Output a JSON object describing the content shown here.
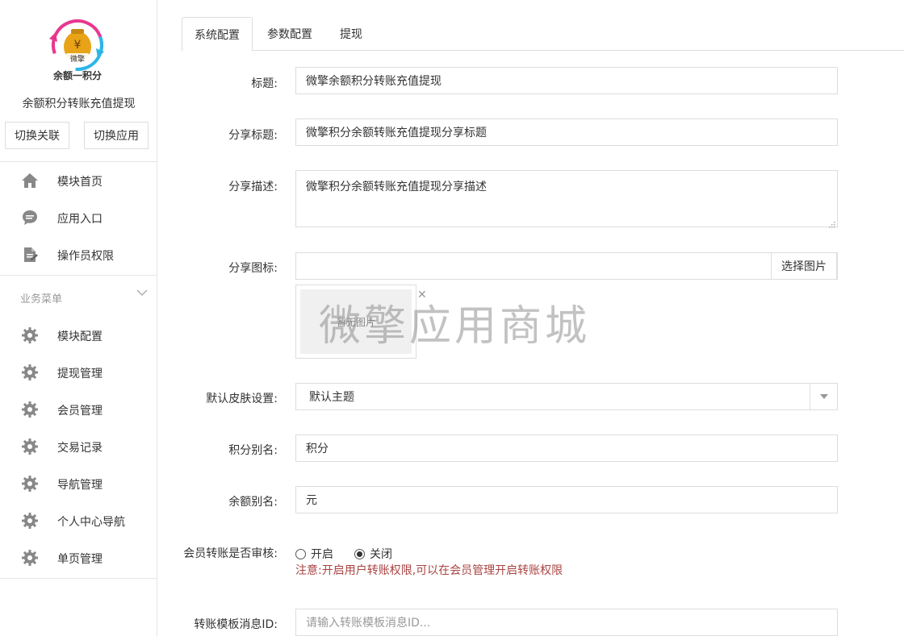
{
  "sidebar": {
    "logo_text": "余额一积分",
    "logo_badge": "微擎",
    "app_name": "余额积分转账充值提现",
    "switch_assoc": "切换关联",
    "switch_app": "切换应用",
    "top_items": [
      {
        "label": "模块首页",
        "icon": "home-icon"
      },
      {
        "label": "应用入口",
        "icon": "chat-icon"
      },
      {
        "label": "操作员权限",
        "icon": "document-icon"
      }
    ],
    "group_title": "业务菜单",
    "group_items": [
      {
        "label": "模块配置",
        "icon": "gear-icon"
      },
      {
        "label": "提现管理",
        "icon": "gear-icon"
      },
      {
        "label": "会员管理",
        "icon": "gear-icon"
      },
      {
        "label": "交易记录",
        "icon": "gear-icon"
      },
      {
        "label": "导航管理",
        "icon": "gear-icon"
      },
      {
        "label": "个人中心导航",
        "icon": "gear-icon"
      },
      {
        "label": "单页管理",
        "icon": "gear-icon"
      }
    ]
  },
  "tabs": [
    {
      "label": "系统配置",
      "active": true
    },
    {
      "label": "参数配置",
      "active": false
    },
    {
      "label": "提现",
      "active": false
    }
  ],
  "form": {
    "title_label": "标题:",
    "title_value": "微擎余额积分转账充值提现",
    "share_title_label": "分享标题:",
    "share_title_value": "微擎积分余额转账充值提现分享标题",
    "share_desc_label": "分享描述:",
    "share_desc_value": "微擎积分余额转账充值提现分享描述",
    "share_icon_label": "分享图标:",
    "share_icon_value": "",
    "choose_image": "选择图片",
    "no_image": "暂无图片",
    "skin_label": "默认皮肤设置:",
    "skin_value": "默认主题",
    "points_alias_label": "积分别名:",
    "points_alias_value": "积分",
    "balance_alias_label": "余额别名:",
    "balance_alias_value": "元",
    "transfer_review_label": "会员转账是否审核:",
    "radio_on": "开启",
    "radio_off": "关闭",
    "radio_selected": "关闭",
    "note": "注意:开启用户转账权限,可以在会员管理开启转账权限",
    "template_id_label": "转账模板消息ID:",
    "template_id_placeholder": "请输入转账模板消息ID..."
  },
  "watermark": "微擎应用商城",
  "colors": {
    "note": "#a94442",
    "border": "#dddddd",
    "logo_pink": "#e8378f",
    "logo_cyan": "#2bb6e8",
    "logo_gold": "#e8a317"
  }
}
